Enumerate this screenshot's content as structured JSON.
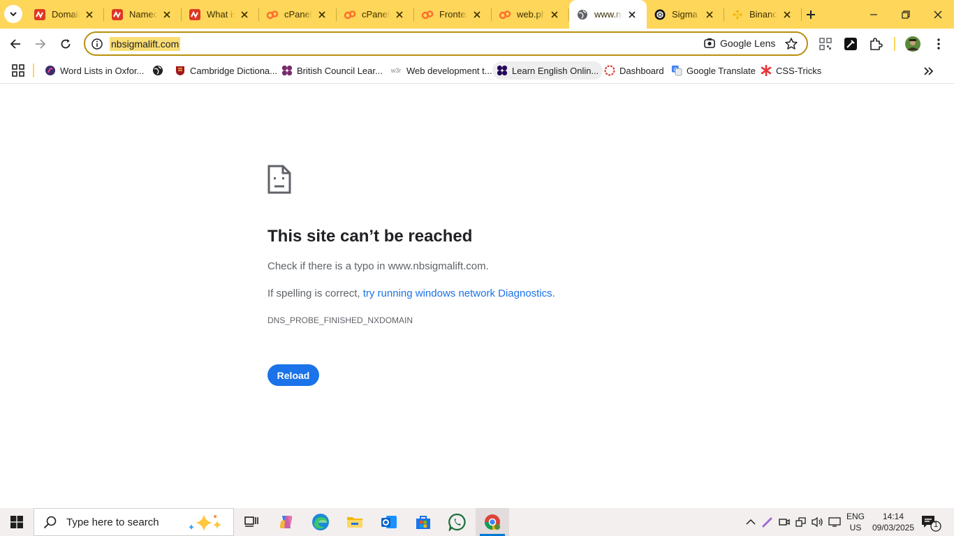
{
  "tabs": [
    {
      "title": "Domain",
      "favicon": "namecheap-icon",
      "active": false
    },
    {
      "title": "Namecheap",
      "favicon": "namecheap-icon",
      "active": false
    },
    {
      "title": "What is",
      "favicon": "namecheap-icon",
      "active": false
    },
    {
      "title": "cPanel",
      "favicon": "cpanel-icon",
      "active": false
    },
    {
      "title": "cPanel F",
      "favicon": "cpanel-icon",
      "active": false
    },
    {
      "title": "Frontend",
      "favicon": "cpanel-icon",
      "active": false
    },
    {
      "title": "web.php",
      "favicon": "cpanel-icon",
      "active": false
    },
    {
      "title": "www.nb",
      "favicon": "globe-icon",
      "active": true
    },
    {
      "title": "Sigma D",
      "favicon": "openai-icon",
      "active": false
    },
    {
      "title": "Binance",
      "favicon": "binance-icon",
      "active": false
    }
  ],
  "toolbar": {
    "url": "nbsigmalift.com",
    "lens_label": "Google Lens"
  },
  "bookmarks": [
    {
      "label": "Word Lists in Oxfor...",
      "icon": "oxford-icon"
    },
    {
      "label": "",
      "icon": "globe-icon"
    },
    {
      "label": "Cambridge Dictiona...",
      "icon": "cambridge-icon"
    },
    {
      "label": "British Council Lear...",
      "icon": "british-council-icon"
    },
    {
      "label": "Web development t...",
      "icon": "w3r-icon"
    },
    {
      "label": "Learn English Onlin...",
      "icon": "british-council-icon"
    },
    {
      "label": "Dashboard",
      "icon": "dashboard-icon"
    },
    {
      "label": "Google Translate",
      "icon": "google-translate-icon"
    },
    {
      "label": "CSS-Tricks",
      "icon": "css-tricks-icon"
    }
  ],
  "error": {
    "title": "This site can’t be reached",
    "check_text": "Check if there is a typo in www.nbsigmalift.com.",
    "spelling_prefix": "If spelling is correct, ",
    "diagnostics_link": "try running windows network Diagnostics",
    "spelling_suffix": ".",
    "code": "DNS_PROBE_FINISHED_NXDOMAIN",
    "reload_label": "Reload"
  },
  "taskbar": {
    "search_placeholder": "Type here to search",
    "lang_top": "ENG",
    "lang_bottom": "US",
    "time": "14:14",
    "date": "09/03/2025",
    "notification_count": "1"
  },
  "colors": {
    "frame": "#fed659",
    "accent": "#1a73e8"
  }
}
